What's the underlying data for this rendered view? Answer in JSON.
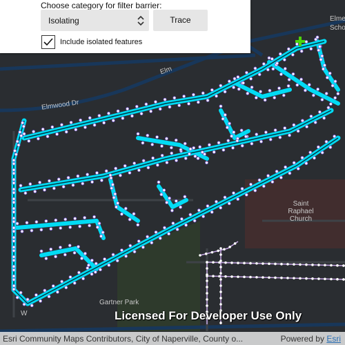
{
  "panel": {
    "category_label": "Choose category for filter barrier:",
    "category_value": "Isolating",
    "trace_button": "Trace",
    "include_isolated_label": "Include isolated features",
    "include_isolated_checked": true
  },
  "map": {
    "street_elmwood_dr": "Elmwood Dr",
    "street_elm": "Elm",
    "park_label": "Gartner Park",
    "church_label": "Saint Raphael Church",
    "school_label_1": "Elmen",
    "school_label_2": "Scho",
    "street_w": "W"
  },
  "watermark": "Licensed For Developer Use Only",
  "attribution": "Esri Community Maps Contributors, City of Naperville, County o...",
  "powered_by": "Powered by",
  "powered_by_link": "Esri",
  "colors": {
    "trace_glow": "#00e5ff",
    "device_points": "#ffffff",
    "starting_point": "#4cd40c",
    "map_background": "#262a2e"
  }
}
